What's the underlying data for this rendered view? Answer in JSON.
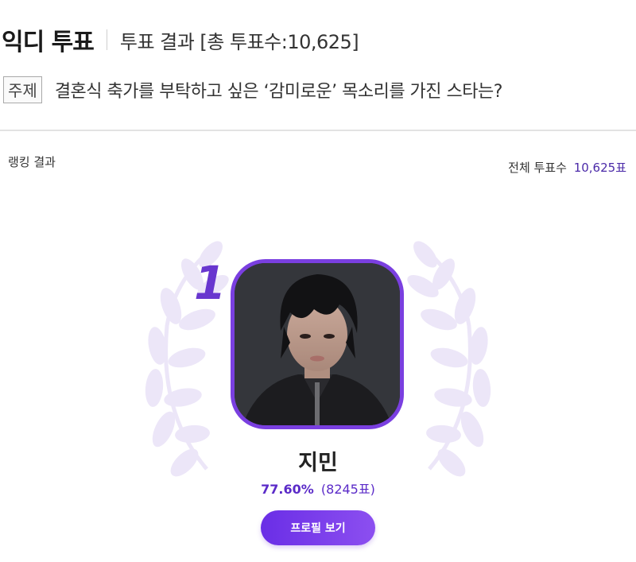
{
  "header": {
    "app_title": "익디 투표",
    "subtitle": "투표 결과 [총 투표수:10,625]"
  },
  "topic": {
    "tag": "주제",
    "question": "결혼식 축가를 부탁하고 싶은 ‘감미로운’ 목소리를 가진 스타는?"
  },
  "ranking": {
    "label": "랭킹 결과",
    "total_label": "전체 투표수",
    "total_value": "10,625표"
  },
  "winner": {
    "rank": "1",
    "name": "지민",
    "percent": "77.60%",
    "votes": "(8245표)",
    "profile_button": "프로필 보기"
  },
  "colors": {
    "accent": "#6836cf",
    "frame": "#7a3fe0",
    "laurel": "#ece6f8"
  }
}
